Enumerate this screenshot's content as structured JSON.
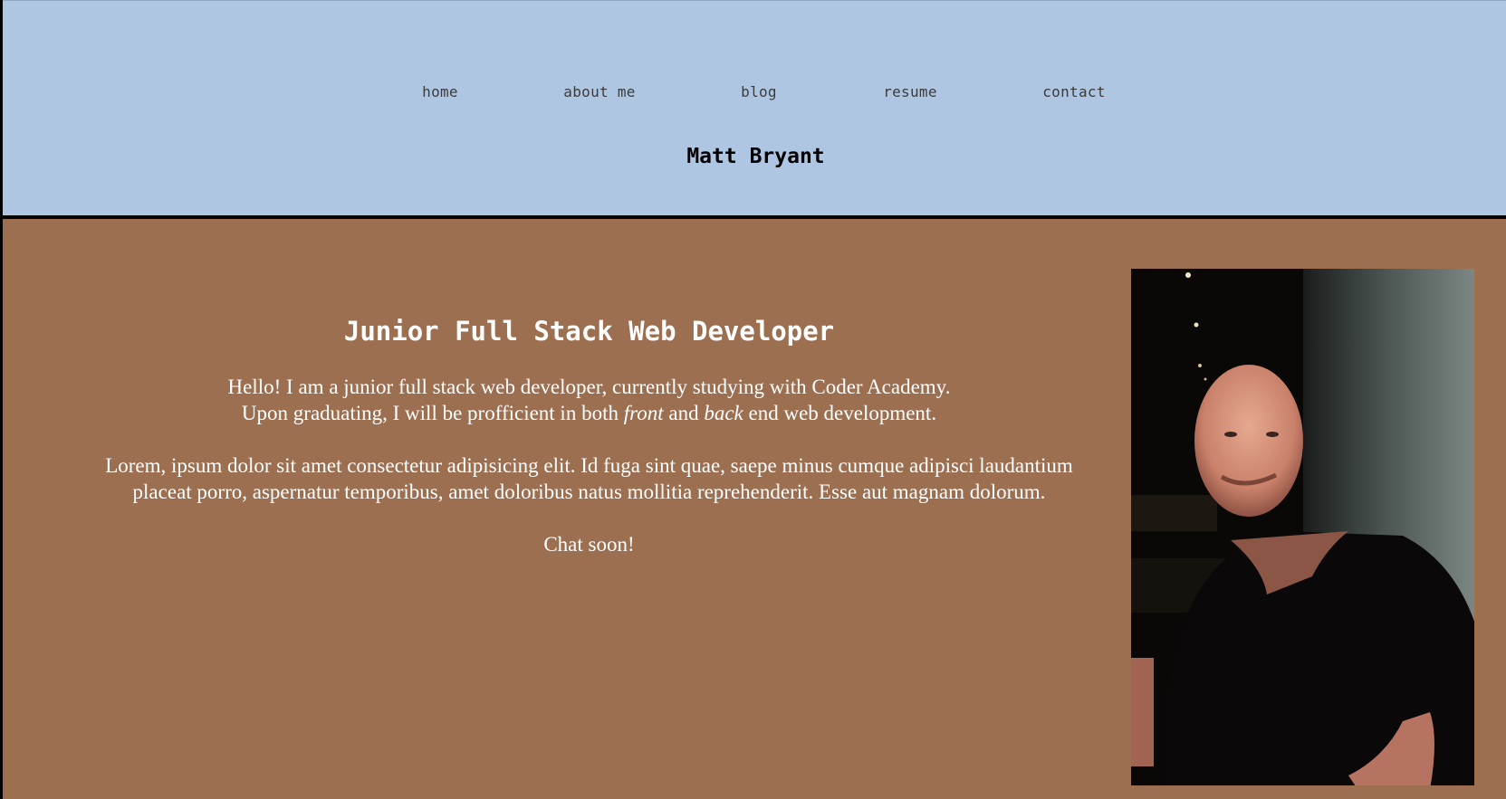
{
  "header": {
    "nav": [
      {
        "label": "home"
      },
      {
        "label": "about me"
      },
      {
        "label": "blog"
      },
      {
        "label": "resume"
      },
      {
        "label": "contact"
      }
    ],
    "site_title": "Matt Bryant"
  },
  "main": {
    "heading": "Junior Full Stack Web Developer",
    "intro_line1": "Hello! I am a junior full stack web developer, currently studying with Coder Academy.",
    "intro_line2_a": "Upon graduating, I will be profficient in both ",
    "intro_line2_front": "front",
    "intro_line2_b": " and ",
    "intro_line2_back": "back",
    "intro_line2_c": " end web development.",
    "lorem": "Lorem, ipsum dolor sit amet consectetur adipisicing elit. Id fuga sint quae, saepe minus cumque adipisci laudantium placeat porro, aspernatur temporibus, amet doloribus natus mollitia reprehenderit. Esse aut magnam dolorum.",
    "signoff": "Chat soon!"
  },
  "colors": {
    "header_bg": "#afc6e3",
    "main_bg": "#9c6f51",
    "text_light": "#ffffff",
    "nav_text": "#3b3b3b"
  }
}
